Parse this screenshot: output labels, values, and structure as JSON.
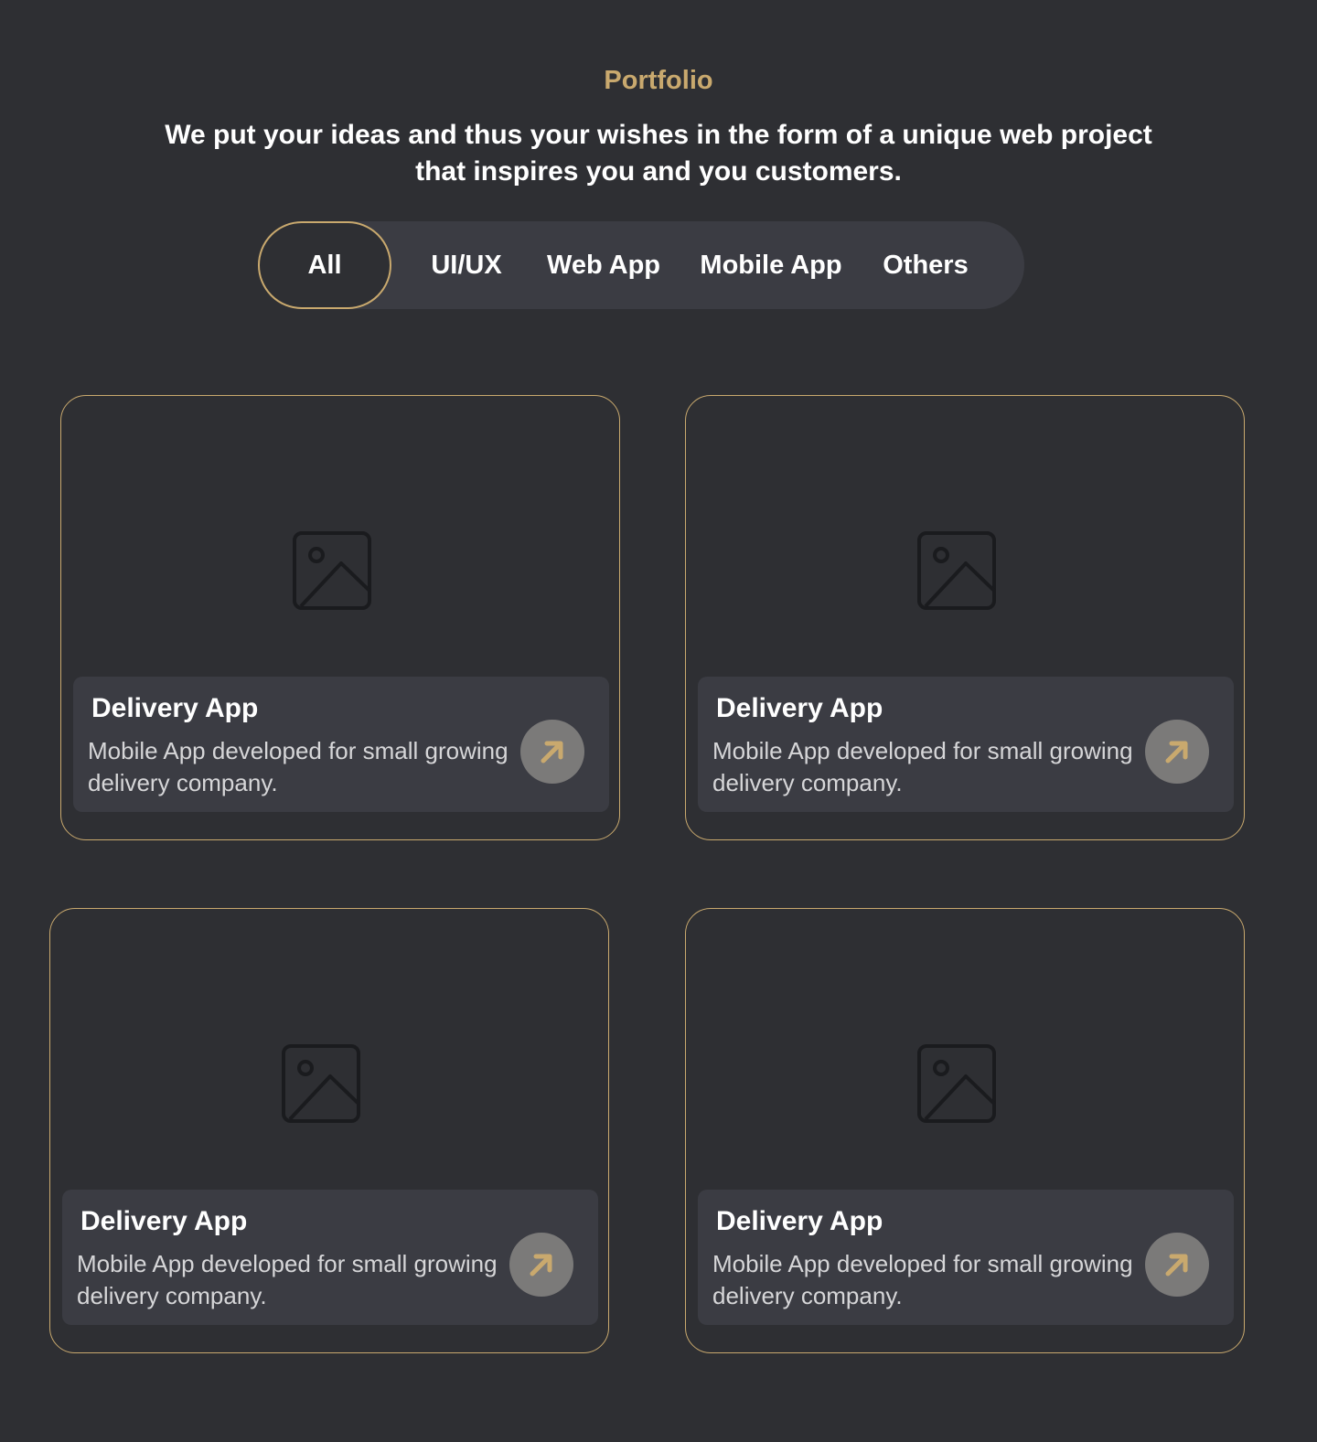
{
  "section": {
    "label": "Portfolio",
    "heading": "We put your ideas and thus your wishes in the form of a unique web project that inspires you and you customers."
  },
  "tabs": [
    {
      "label": "All",
      "active": true
    },
    {
      "label": "UI/UX",
      "active": false
    },
    {
      "label": "Web App",
      "active": false
    },
    {
      "label": "Mobile App",
      "active": false
    },
    {
      "label": "Others",
      "active": false
    }
  ],
  "projects": [
    {
      "title": "Delivery App",
      "description": "Mobile App developed for small growing delivery company.",
      "image_icon": "image-placeholder-icon",
      "action_icon": "arrow-up-right-icon"
    },
    {
      "title": "Delivery App",
      "description": "Mobile App developed for small growing delivery company.",
      "image_icon": "image-placeholder-icon",
      "action_icon": "arrow-up-right-icon"
    },
    {
      "title": "Delivery App",
      "description": "Mobile App developed for small growing delivery company.",
      "image_icon": "image-placeholder-icon",
      "action_icon": "arrow-up-right-icon"
    },
    {
      "title": "Delivery App",
      "description": "Mobile App developed for small growing delivery company.",
      "image_icon": "image-placeholder-icon",
      "action_icon": "arrow-up-right-icon"
    }
  ],
  "colors": {
    "background": "#2e2f33",
    "accent": "#c9a96e",
    "panel": "#3b3c43",
    "button": "#7b7a79"
  }
}
